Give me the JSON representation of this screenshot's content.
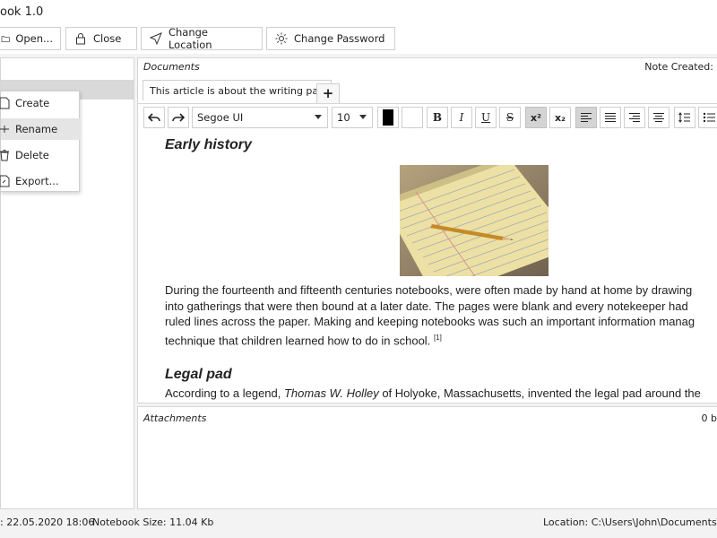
{
  "window": {
    "title": "ook 1.0"
  },
  "toolbar": {
    "open_label": "Open...",
    "close_label": "Close",
    "change_location_label": "Change Location",
    "change_password_label": "Change Password"
  },
  "context_menu": {
    "items": [
      {
        "label": "Create"
      },
      {
        "label": "Rename"
      },
      {
        "label": "Delete"
      },
      {
        "label": "Export..."
      }
    ]
  },
  "documents": {
    "header": "Documents",
    "note_created_label": "Note Created:",
    "active_tab": "This article is about the writing pad",
    "add_tab_label": "+"
  },
  "format_bar": {
    "font_family": "Segoe UI",
    "font_size": "10",
    "bold": "B",
    "italic": "I",
    "underline": "U",
    "strike": "S",
    "superscript": "x²",
    "subscript": "x₂"
  },
  "article": {
    "heading1": "Early history",
    "para1": [
      "During the fourteenth and fifteenth centuries notebooks, were often made by hand at home by drawing",
      "into gatherings that were then bound at a later date. The pages were blank and every notekeeper had",
      "ruled lines across the paper. Making and keeping notebooks was such an important information manag",
      "technique that children learned how to do in school."
    ],
    "footnote": "[1]",
    "heading2": "Legal pad",
    "para2_start": "According to a legend, ",
    "para2_name": "Thomas W. Holley",
    "para2_end": " of Holyoke, Massachusetts, invented the legal pad around the"
  },
  "attachments": {
    "header": "Attachments",
    "size": "0 b"
  },
  "status": {
    "created": ": 22.05.2020 18:06",
    "notebook_size": "Notebook Size: 11.04 Kb",
    "location": "Location: C:\\Users\\John\\Documents\\M"
  },
  "colors": {
    "accent_selected": "#d9d9d9",
    "text_color_swatch": "#000000",
    "highlight_swatch": "#ffffff"
  }
}
